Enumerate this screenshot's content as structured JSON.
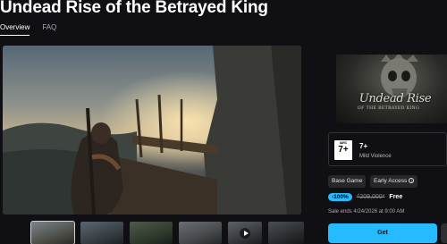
{
  "page": {
    "title": "Undead Rise of the Betrayed King",
    "tabs": [
      {
        "label": "Overview",
        "active": true
      },
      {
        "label": "FAQ",
        "active": false
      }
    ]
  },
  "media": {
    "thumbnails": [
      {
        "kind": "image",
        "active": true
      },
      {
        "kind": "image",
        "active": false
      },
      {
        "kind": "image",
        "active": false
      },
      {
        "kind": "image",
        "active": false
      },
      {
        "kind": "video",
        "active": false
      },
      {
        "kind": "image",
        "active": false
      }
    ]
  },
  "sidebar": {
    "cover_title": "Undead Rise",
    "cover_subtitle": "OF THE BETRAYED KING",
    "rating": {
      "badge_top": "IARC",
      "badge_age": "7+",
      "age_label": "7+",
      "descriptor": "Mild Violence"
    },
    "tags": [
      "Base Game",
      "Early Access"
    ],
    "info_glyph": "i",
    "discount": "-100%",
    "original_price": "₫209,000*",
    "current_price": "Free",
    "sale_ends": "Sale ends 4/24/2026 at 9:00 AM",
    "get_label": "Get"
  },
  "colors": {
    "accent": "#26bbff",
    "background": "#101014",
    "tag_background": "#26262b"
  },
  "icons": {
    "info": "info-circle-icon",
    "play": "play-icon"
  }
}
